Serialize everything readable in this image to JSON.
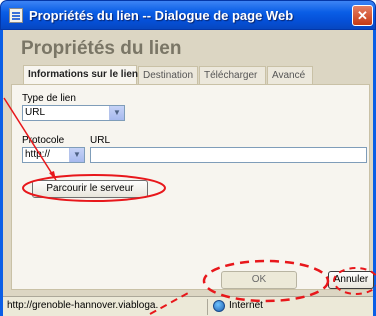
{
  "window": {
    "title": "Propriétés du lien -- Dialogue de page Web",
    "close_glyph": "✕"
  },
  "dialog": {
    "heading": "Propriétés du lien",
    "tabs": [
      {
        "label": "Informations sur le lien",
        "active": true
      },
      {
        "label": "Destination",
        "active": false
      },
      {
        "label": "Télécharger",
        "active": false
      },
      {
        "label": "Avancé",
        "active": false
      }
    ],
    "link_type": {
      "label": "Type de lien",
      "value": "URL"
    },
    "protocol": {
      "label": "Protocole",
      "value": "http://"
    },
    "url": {
      "label": "URL",
      "value": ""
    },
    "browse_button": "Parcourir le serveur",
    "ok_button": "OK",
    "cancel_button": "Annuler"
  },
  "statusbar": {
    "url": "http://grenoble-hannover.viabloga.",
    "zone": "Internet",
    "zone_icon": "globe-icon"
  },
  "annotation": {
    "color": "#e8171b"
  }
}
